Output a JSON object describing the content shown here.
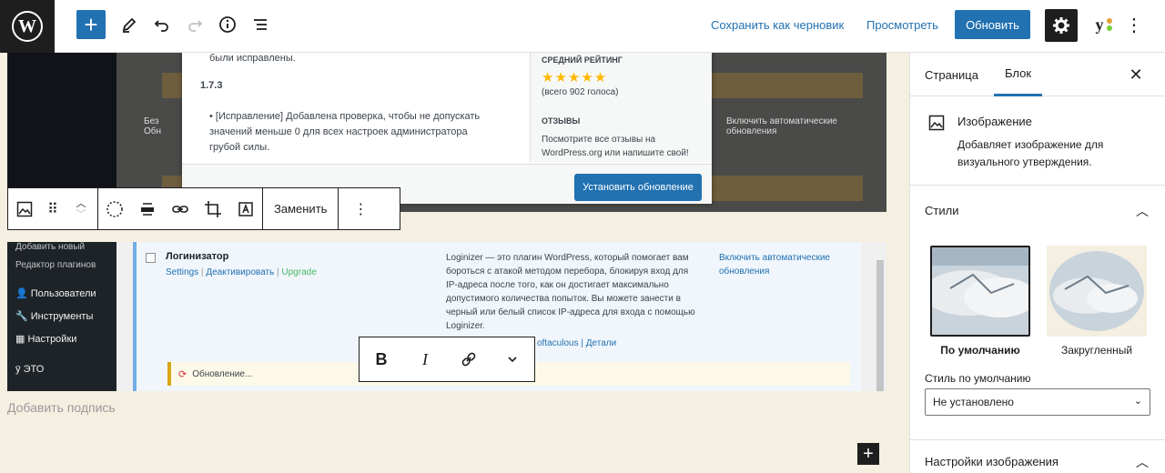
{
  "topbar": {
    "draft_label": "Сохранить как черновик",
    "preview_label": "Просмотреть",
    "update_label": "Обновить",
    "logo_letter": "W"
  },
  "screenshot_top": {
    "left_text": "были исправлены.",
    "version": "1.7.3",
    "fix_text": "[Исправление] Добавлена проверка, чтобы не допускать значений меньше 0 для всех настроек администратора грубой силы.",
    "rating_heading": "СРЕДНИЙ РЕЙТИНГ",
    "rating_count": "(всего 902 голоса)",
    "reviews_heading": "ОТЗЫВЫ",
    "reviews_text": "Посмотрите все отзывы на WordPress.org или напишите свой!",
    "install_label": "Установить обновление",
    "side_label": "Включить автоматические обновления",
    "side_short": "Без",
    "side_short2": "Обн",
    "stars": "★★★★★"
  },
  "block_toolbar": {
    "replace_label": "Заменить"
  },
  "screenshot_bottom": {
    "menu_items": [
      "Добавить новый",
      "Редактор плагинов",
      "Пользователи",
      "Инструменты",
      "Настройки",
      "ЭТО"
    ],
    "plugin_name": "Логинизатор",
    "plugin_links": [
      "Settings",
      "Деактивировать",
      "Upgrade"
    ],
    "plugin_desc": "Loginizer — это плагин WordPress, который помогает вам бороться с атакой методом перебора, блокируя вход для IP-адреса после того, как он достигает максимально допустимого количества попыток. Вы можете занести в черный или белый список IP-адреса для входа с помощью Loginizer.",
    "plugin_meta": "oftaculous | Детали",
    "auto_update": "Включить автоматические обновления",
    "notice_text": "Обновление..."
  },
  "caption_placeholder": "Добавить подпись",
  "sidebar": {
    "tabs": [
      "Страница",
      "Блок"
    ],
    "block_title": "Изображение",
    "block_desc": "Добавляет изображение для визуального утверждения.",
    "styles_heading": "Стили",
    "style_default": "По умолчанию",
    "style_rounded": "Закругленный",
    "default_style_label": "Стиль по умолчанию",
    "default_style_value": "Не установлено",
    "image_settings_heading": "Настройки изображения"
  },
  "colors": {
    "accent": "#2271b1",
    "canvas": "#f5efe1",
    "dark": "#1e1e1e"
  }
}
